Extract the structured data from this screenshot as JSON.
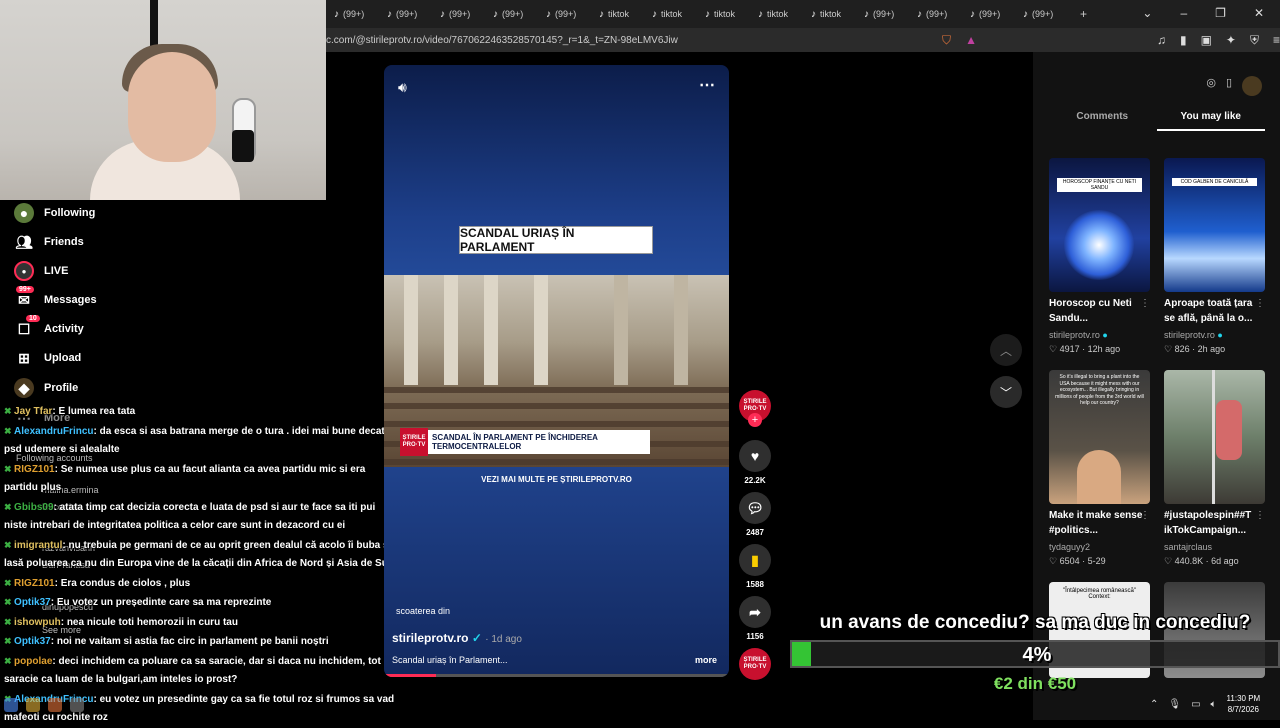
{
  "browser": {
    "tab_label": "(99+)",
    "tiktok_tab_label": "tiktok",
    "url": "c.com/@stirileprotv.ro/video/7670622463528570145?_r=1&_t=ZN-98eLMV6Jiw",
    "new_tab": "+"
  },
  "sidebar": {
    "items": [
      {
        "label": "Following",
        "icon": "following-avatar-icon"
      },
      {
        "label": "Friends",
        "icon": "friends-icon"
      },
      {
        "label": "LIVE",
        "icon": "live-icon"
      },
      {
        "label": "Messages",
        "icon": "messages-icon",
        "badge": "99+"
      },
      {
        "label": "Activity",
        "icon": "activity-icon",
        "badge": "10"
      },
      {
        "label": "Upload",
        "icon": "upload-icon"
      },
      {
        "label": "Profile",
        "icon": "profile-icon"
      },
      {
        "label": "More",
        "icon": "more-icon"
      }
    ],
    "following_heading": "Following accounts",
    "following": [
      "malina.ermina",
      "Recorder",
      "razvanvisann",
      "Dan Tanasă",
      "dinupopescu"
    ],
    "see_more": "See more"
  },
  "chat": [
    {
      "user": "Jay Tfar",
      "text": ": E lumea rea tata",
      "color": "#e0c060"
    },
    {
      "user": "AlexandruFrincu",
      "text": ": da esca si asa batrana merge de o tura . idei mai bune decat psd udemere si alealalte",
      "color": "#3fc1ff"
    },
    {
      "user": "RIGZ101",
      "text": ": Se numea use plus ca au facut alianta ca avea partidu mic si era partidu plus",
      "color": "#e0a030"
    },
    {
      "user": "Gbibs09",
      "text": ": atata timp cat decizia corecta e luata de psd si aur te face sa iti pui niste intrebari de integritatea politica a celor care sunt in dezacord cu ei",
      "color": "#3cb043"
    },
    {
      "user": "imigrantul",
      "text": ": nu trebuia pe germani de ce au oprit green dealul că acolo îi buba și lasă poluarea ca nu din Europa vine de la căcații din Africa de Nord și Asia de Sud",
      "color": "#e0c060"
    },
    {
      "user": "RIGZ101",
      "text": ": Era condus de ciolos , plus",
      "color": "#e0a030"
    },
    {
      "user": "Optik37",
      "text": ": Eu votez un președinte care sa ma reprezinte",
      "color": "#3fc1ff"
    },
    {
      "user": "ishowpuh",
      "text": ": nea nicule toti hemorozii in curu tau",
      "color": "#e0c060"
    },
    {
      "user": "Optik37",
      "text": ": noi ne vaitam si astia fac circ in parlament pe banii noștri",
      "color": "#3fc1ff"
    },
    {
      "user": "popolae",
      "text": ": deci inchidem ca poluare ca sa saracie, dar si daca nu inchidem, tot saracie ca luam de la bulgari,am inteles io prost?",
      "color": "#e0a030"
    },
    {
      "user": "AlexandruFrincu",
      "text": ": eu votez un presedinte gay ca sa fie totul roz si frumos sa vad mafeoti cu rochite roz",
      "color": "#3fc1ff"
    }
  ],
  "video": {
    "headline": "SCANDAL URIAȘ ÎN PARLAMENT",
    "lower_third": "SCANDAL ÎN PARLAMENT PE ÎNCHIDEREA TERMOCENTRALELOR",
    "lower_third_logo": "ȘTIRILE PRO·TV",
    "vezi": "VEZI MAI MULTE PE ȘTIRILEPROTV.RO",
    "caption_word": "scoaterea din",
    "author": "stirileprotv.ro",
    "verified": "✓",
    "date": "· 1d ago",
    "caption": "Scandal uriaș în Parlament...",
    "more": "more",
    "progress": 0.15
  },
  "actions": {
    "likes": "22.2K",
    "comments": "2487",
    "saves": "1588",
    "shares": "1156",
    "avatar_text": "ȘTIRILE PRO·TV",
    "follow": "+"
  },
  "right_panel": {
    "tabs": [
      {
        "label": "Comments",
        "active": false
      },
      {
        "label": "You may like",
        "active": true
      }
    ],
    "cards": [
      {
        "title": "Horoscop cu Neti Sandu...",
        "author": "stirileprotv.ro",
        "verified": true,
        "views": "4917",
        "age": "12h ago",
        "thumb_text": "HOROSCOP FINANȚE CU NETI SANDU"
      },
      {
        "title": "Aproape toată țara se află, până la o...",
        "author": "stirileprotv.ro",
        "verified": true,
        "views": "826",
        "age": "2h ago",
        "thumb_text": "COD GALBEN DE CANICULĂ"
      },
      {
        "title": "Make it make sense #politics...",
        "author": "tydaguyy2",
        "verified": false,
        "views": "6504",
        "age": "5-29",
        "thumb_text": "So it's illegal to bring a plant into the USA because it might mess with our ecosystem... But illegally bringing in millions of people from the 3rd world will help our country?"
      },
      {
        "title": "#justapolespin##T ikTokCampaign...",
        "author": "santajrclaus",
        "verified": false,
        "views": "440.8K",
        "age": "6d ago",
        "thumb_text": ""
      },
      {
        "title": "",
        "author": "",
        "verified": false,
        "views": "",
        "age": "",
        "thumb_text": "\"Întâlpecimea românească\" Context:"
      }
    ]
  },
  "donation": {
    "message": "un avans de concediu? sa ma duc in concediu?",
    "percent_label": "4%",
    "percent": 0.04,
    "amount": "€2 din €50"
  },
  "taskbar": {
    "time": "11:30 PM",
    "date": "8/7/2026"
  }
}
